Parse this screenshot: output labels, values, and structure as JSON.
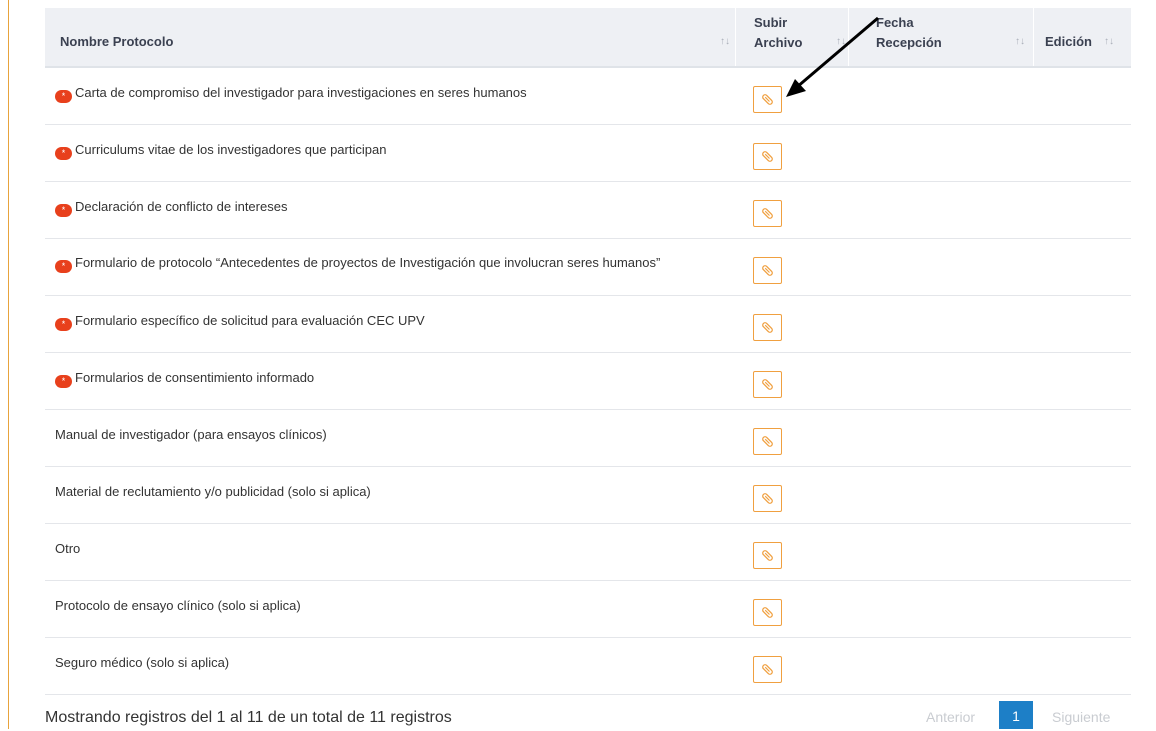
{
  "table": {
    "headers": {
      "name": "Nombre Protocolo",
      "upload_line1": "Subir",
      "upload_line2": "Archivo",
      "date_line1": "Fecha",
      "date_line2": "Recepción",
      "edit": "Edición"
    },
    "sort_glyph": "↑↓",
    "required_marker": "*",
    "rows": [
      {
        "name": "Carta de compromiso del investigador para investigaciones en seres humanos",
        "required": true
      },
      {
        "name": "Curriculums vitae de los investigadores que participan",
        "required": true
      },
      {
        "name": "Declaración de conflicto de intereses",
        "required": true
      },
      {
        "name": "Formulario de protocolo “Antecedentes de proyectos de Investigación que involucran seres humanos”",
        "required": true
      },
      {
        "name": "Formulario específico de solicitud para evaluación CEC UPV",
        "required": true
      },
      {
        "name": "Formularios de consentimiento informado",
        "required": true
      },
      {
        "name": "Manual de investigador (para ensayos clínicos)",
        "required": false
      },
      {
        "name": "Material de reclutamiento y/o publicidad (solo si aplica)",
        "required": false
      },
      {
        "name": "Otro",
        "required": false
      },
      {
        "name": "Protocolo de ensayo clínico (solo si aplica)",
        "required": false
      },
      {
        "name": "Seguro médico (solo si aplica)",
        "required": false
      }
    ]
  },
  "footer": {
    "summary": "Mostrando registros del 1 al 11 de un total de 11 registros",
    "prev": "Anterior",
    "page": "1",
    "next": "Siguiente"
  },
  "icons": {
    "upload": "paperclip-icon",
    "annotation": "arrow-annotation"
  },
  "colors": {
    "accent": "#f0a040",
    "required": "#e8401c",
    "pager_active": "#1d7fc7"
  }
}
